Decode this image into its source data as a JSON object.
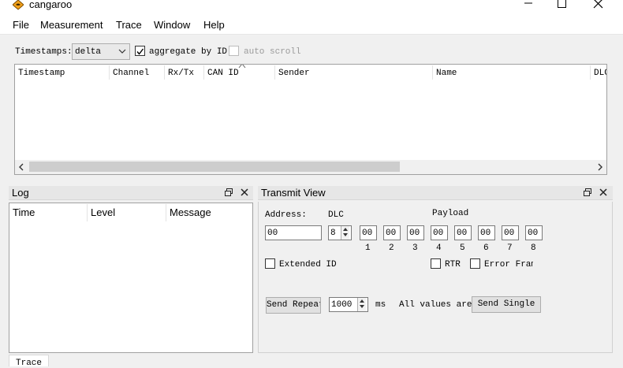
{
  "window": {
    "title": "cangaroo"
  },
  "menu": [
    "File",
    "Measurement",
    "Trace",
    "Window",
    "Help"
  ],
  "toolbar": {
    "timestamps_label": "Timestamps:",
    "timestamps_value": "delta",
    "aggregate_label": "aggregate by ID",
    "aggregate_checked": true,
    "autoscroll_label": "auto scroll",
    "autoscroll_checked": false,
    "autoscroll_enabled": false
  },
  "trace": {
    "columns": [
      "Timestamp",
      "Channel",
      "Rx/Tx",
      "CAN ID",
      "Sender",
      "Name",
      "DLC"
    ],
    "rows": []
  },
  "log": {
    "title": "Log",
    "columns": [
      "Time",
      "Level",
      "Message"
    ],
    "rows": []
  },
  "transmit": {
    "title": "Transmit View",
    "address_label": "Address:",
    "address_value": "00",
    "dlc_label": "DLC",
    "dlc_value": "8",
    "payload_label": "Payload",
    "payload": [
      "00",
      "00",
      "00",
      "00",
      "00",
      "00",
      "00",
      "00"
    ],
    "payload_index": [
      "1",
      "2",
      "3",
      "4",
      "5",
      "6",
      "7",
      "8"
    ],
    "extended_id_label": "Extended ID",
    "extended_id_checked": false,
    "rtr_label": "RTR",
    "rtr_checked": false,
    "error_frame_label": "Error Frame",
    "error_frame_checked": false,
    "send_repeat_label": "Send Repeat",
    "interval_value": "1000",
    "interval_unit": "ms",
    "values_note": "All values are hex",
    "send_single_label": "Send Single"
  },
  "status_tabs": [
    "Trace"
  ],
  "colors": {
    "accent_logo": "#f2a11a",
    "panel_bg": "#f0f0f0",
    "dock_title_bg": "#e6e6e6"
  }
}
